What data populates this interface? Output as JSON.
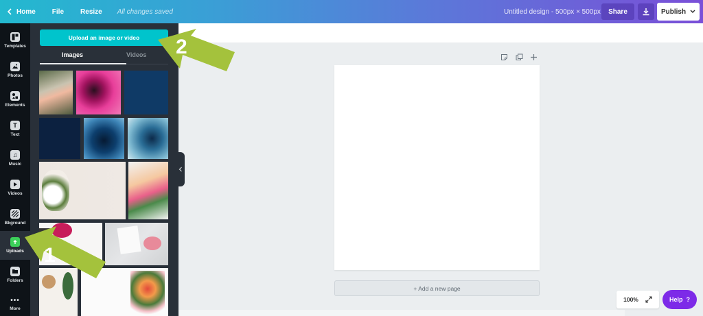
{
  "topbar": {
    "home": "Home",
    "file": "File",
    "resize": "Resize",
    "saved_status": "All changes saved",
    "doc_title": "Untitled design - 500px × 500px",
    "share": "Share",
    "publish": "Publish"
  },
  "rail": {
    "items": [
      {
        "label": "Templates",
        "icon": "templates-icon"
      },
      {
        "label": "Photos",
        "icon": "photos-icon"
      },
      {
        "label": "Elements",
        "icon": "elements-icon"
      },
      {
        "label": "Text",
        "icon": "text-icon"
      },
      {
        "label": "Music",
        "icon": "music-icon"
      },
      {
        "label": "Videos",
        "icon": "videos-icon"
      },
      {
        "label": "Bkground",
        "icon": "background-icon"
      },
      {
        "label": "Uploads",
        "icon": "uploads-icon"
      },
      {
        "label": "Folders",
        "icon": "folders-icon"
      },
      {
        "label": "More",
        "icon": "more-icon"
      }
    ],
    "active": "Uploads"
  },
  "panel": {
    "upload_button": "Upload an image or video",
    "tabs": [
      "Images",
      "Videos"
    ],
    "active_tab": "Images"
  },
  "canvas": {
    "add_page": "+ Add a new page",
    "zoom": "100%",
    "help": "Help",
    "help_mark": "?"
  },
  "annotations": {
    "step1": "1",
    "step2": "2",
    "arrow_color": "#a4c23c"
  },
  "colors": {
    "accent": "#00c4cc",
    "help": "#7d2ae8",
    "rail_bg": "#0e1318",
    "panel_bg": "#293039"
  }
}
